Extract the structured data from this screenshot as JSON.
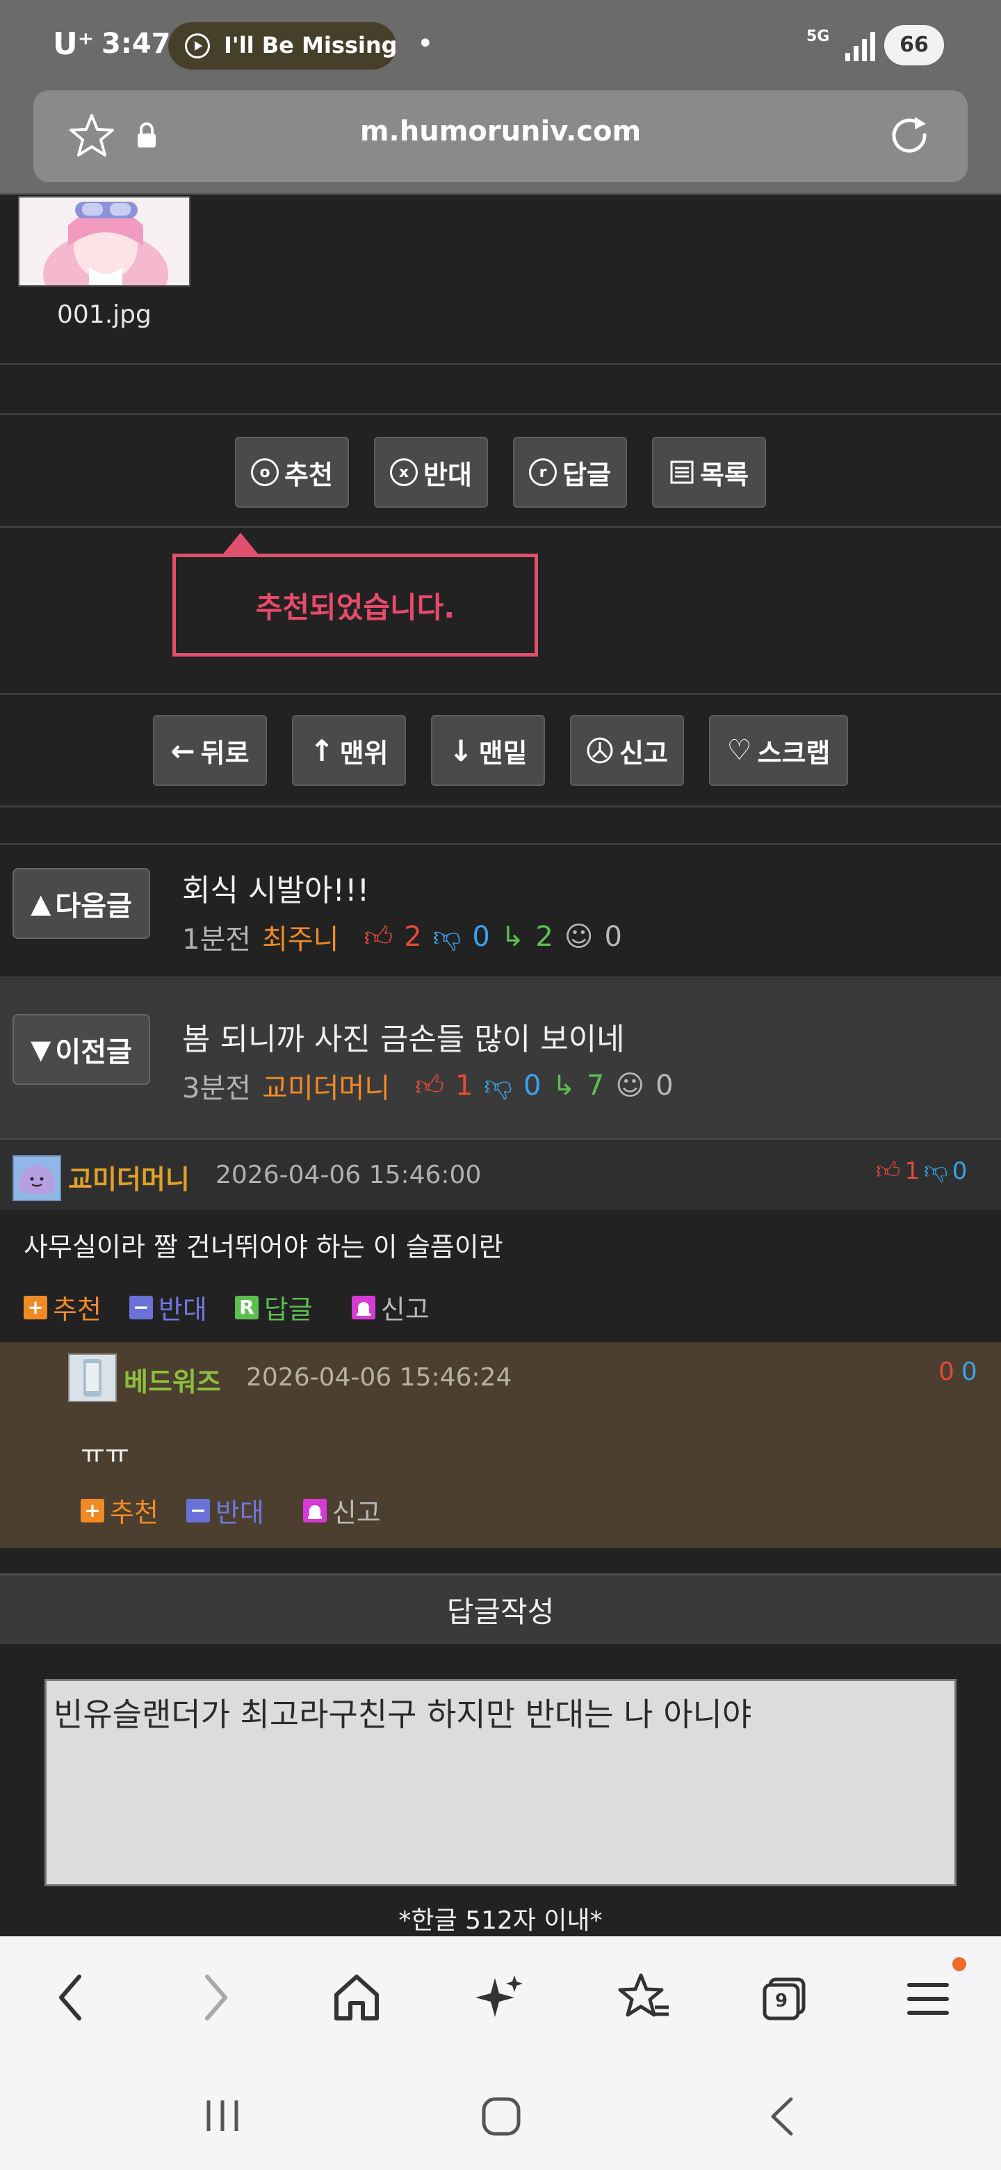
{
  "status": {
    "carrier": "U⁺",
    "time": "3:47",
    "music": "I'll Be Missing",
    "dot": "•",
    "network": "5G",
    "battery": "66"
  },
  "browser": {
    "url": "m.humoruniv.com"
  },
  "attachment": {
    "filename": "001.jpg"
  },
  "actions": {
    "recommend": "추천",
    "oppose": "반대",
    "reply": "답글",
    "list": "목록",
    "recommend_letter": "o",
    "oppose_letter": "x",
    "reply_letter": "r"
  },
  "toast": "추천되었습니다.",
  "nav2": {
    "back": "뒤로",
    "top": "맨위",
    "bottom": "맨밑",
    "report": "신고",
    "scrap": "스크랩"
  },
  "next_post": {
    "button": "다음글",
    "title": "회식 시발아!!!",
    "time": "1분전",
    "author": "최주니",
    "up": "2",
    "down": "0",
    "replies": "2",
    "views": "0"
  },
  "prev_post": {
    "button": "이전글",
    "title": "봄 되니까 사진 금손들 많이 보이네",
    "time": "3분전",
    "author": "교미더머니",
    "up": "1",
    "down": "0",
    "replies": "7",
    "views": "0"
  },
  "comment": {
    "author": "교미더머니",
    "date": "2026-04-06 15:46:00",
    "up": "1",
    "down": "0",
    "text": "사무실이라 짤 건너뛰어야 하는 이 슬픔이란",
    "recommend": "추천",
    "oppose": "반대",
    "reply": "답글",
    "report": "신고"
  },
  "reply": {
    "author": "베드워즈",
    "date": "2026-04-06 15:46:24",
    "up": "0",
    "down": "0",
    "text": "ㅠㅠ",
    "recommend": "추천",
    "oppose": "반대",
    "report": "신고"
  },
  "write": {
    "header": "답글작성",
    "value": "빈유슬랜더가 최고라구친구 하지만 반대는 나 아니야",
    "limit": "*한글 512자 이내*"
  },
  "bottom_nav": {
    "tabs_count": "9"
  },
  "colors": {
    "recommend": "#f08a24",
    "oppose": "#6a72d8",
    "reply": "#5cbe50",
    "report": "#d63bd6"
  }
}
